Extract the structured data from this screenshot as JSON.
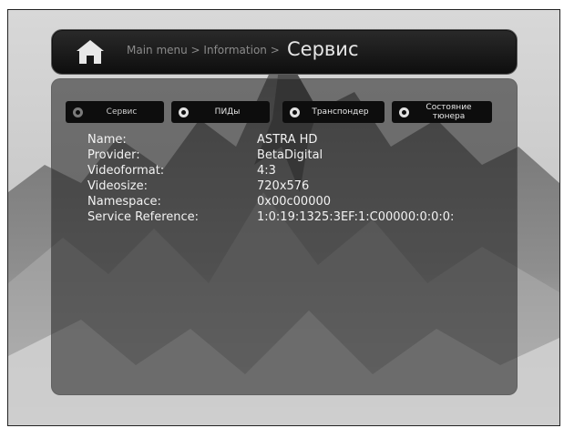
{
  "header": {
    "breadcrumb": "Main menu > Information >",
    "title": "Сервис"
  },
  "tabs": [
    {
      "label": "Сервис",
      "active": true
    },
    {
      "label": "ПИДы",
      "active": false
    },
    {
      "label": "Транспондер",
      "active": false
    },
    {
      "label": "Состояние тюнера",
      "active": false
    }
  ],
  "info": [
    {
      "key": "Name:",
      "value": "ASTRA HD"
    },
    {
      "key": "Provider:",
      "value": "BetaDigital"
    },
    {
      "key": "Videoformat:",
      "value": "4:3"
    },
    {
      "key": "Videosize:",
      "value": "720x576"
    },
    {
      "key": "Namespace:",
      "value": "0x00c00000"
    },
    {
      "key": "Service Reference:",
      "value": "1:0:19:1325:3EF:1:C00000:0:0:0:"
    }
  ],
  "icons": {
    "home": "home-icon"
  },
  "colors": {
    "panel": "#1e1e1e",
    "text": "#f2f2f2",
    "crumb": "#8a8a8a"
  }
}
